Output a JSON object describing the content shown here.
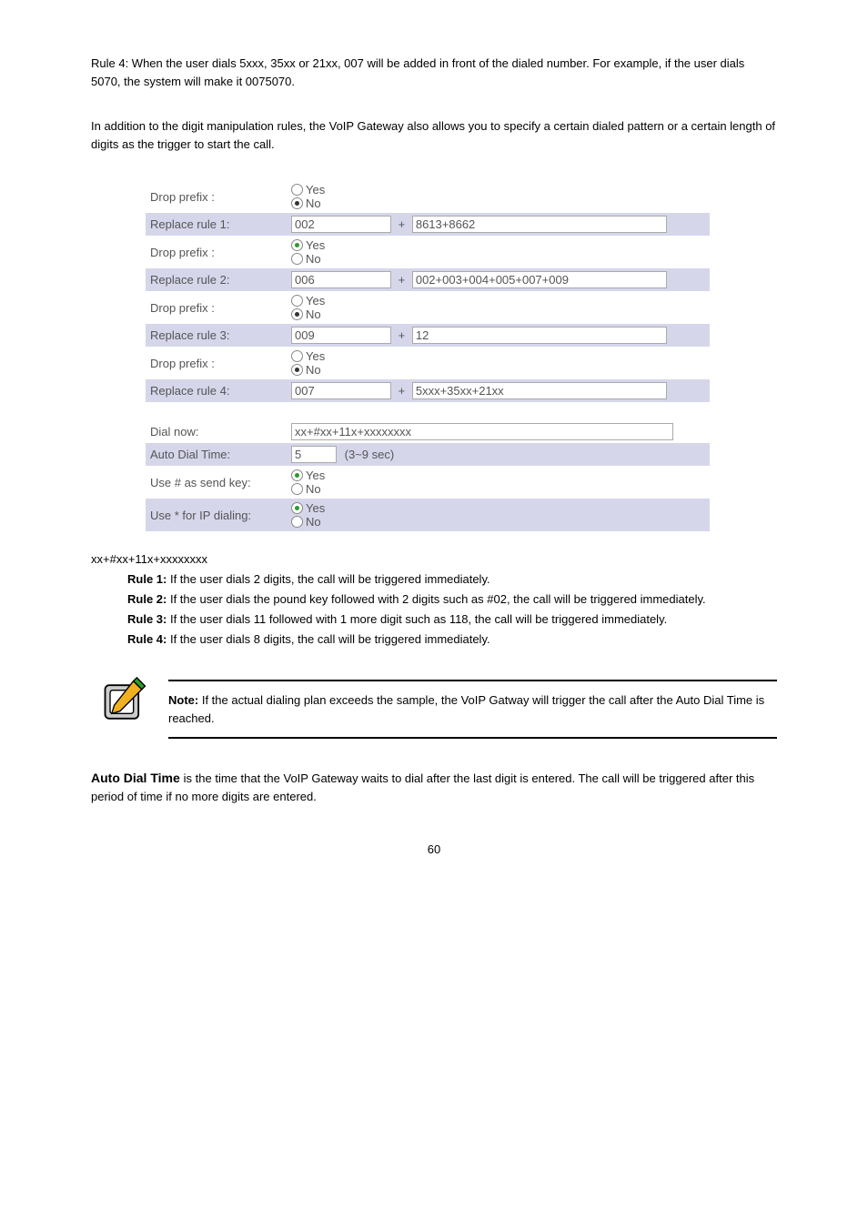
{
  "explanation": [
    "Rule 4: When the user dials 5xxx, 35xx or 21xx, 007 will be added in front of the dialed number. For example, if the user dials 5070, the system will make it 0075070.",
    "In addition to the digit manipulation rules, the VoIP Gateway also allows you to specify a certain dialed pattern or a certain length of digits as the trigger to start the call."
  ],
  "yes": "Yes",
  "no": "No",
  "rows": {
    "drop_prefix_label": "Drop prefix :",
    "replace_rule_1_label": "Replace rule 1:",
    "replace_rule_1_a": "002",
    "replace_rule_1_b": "8613+8662",
    "drop_prefix_2_checked": "yes",
    "replace_rule_2_label": "Replace rule 2:",
    "replace_rule_2_a": "006",
    "replace_rule_2_b": "002+003+004+005+007+009",
    "replace_rule_3_label": "Replace rule 3:",
    "replace_rule_3_a": "009",
    "replace_rule_3_b": "12",
    "replace_rule_4_label": "Replace rule 4:",
    "replace_rule_4_a": "007",
    "replace_rule_4_b": "5xxx+35xx+21xx",
    "dial_now_label": "Dial now:",
    "dial_now_value": "xx+#xx+11x+xxxxxxxx",
    "auto_dial_label": "Auto Dial Time:",
    "auto_dial_value": "5",
    "auto_dial_hint": "(3~9 sec)",
    "send_key_label": "Use # as send key:",
    "ip_dialing_label": "Use * for IP dialing:"
  },
  "plus": "+",
  "rules": {
    "heading": "xx+#xx+11x+xxxxxxxx",
    "r1_bold": "Rule 1:",
    "r1_text": " If the user dials 2 digits, the call will be triggered immediately.",
    "r2_bold": "Rule 2:",
    "r2_text": " If the user dials the pound key followed with 2 digits such as #02, the call will be triggered immediately.",
    "r3_bold": "Rule 3:",
    "r3_text": " If the user dials 11 followed with 1 more digit such as 118, the call will be triggered immediately.",
    "r4_bold": "Rule 4:",
    "r4_text": " If the user dials 8 digits, the call will be triggered immediately."
  },
  "note": {
    "bold": "Note: ",
    "text": "If the actual dialing plan exceeds the sample, the VoIP Gatway will trigger the call after the Auto Dial Time is reached."
  },
  "auto_dial_para": {
    "bold": "Auto Dial Time ",
    "text": "is the time that the VoIP Gateway waits to dial after the last digit is entered. The call will be triggered after this period of time if no more digits are entered."
  },
  "footer": "60"
}
